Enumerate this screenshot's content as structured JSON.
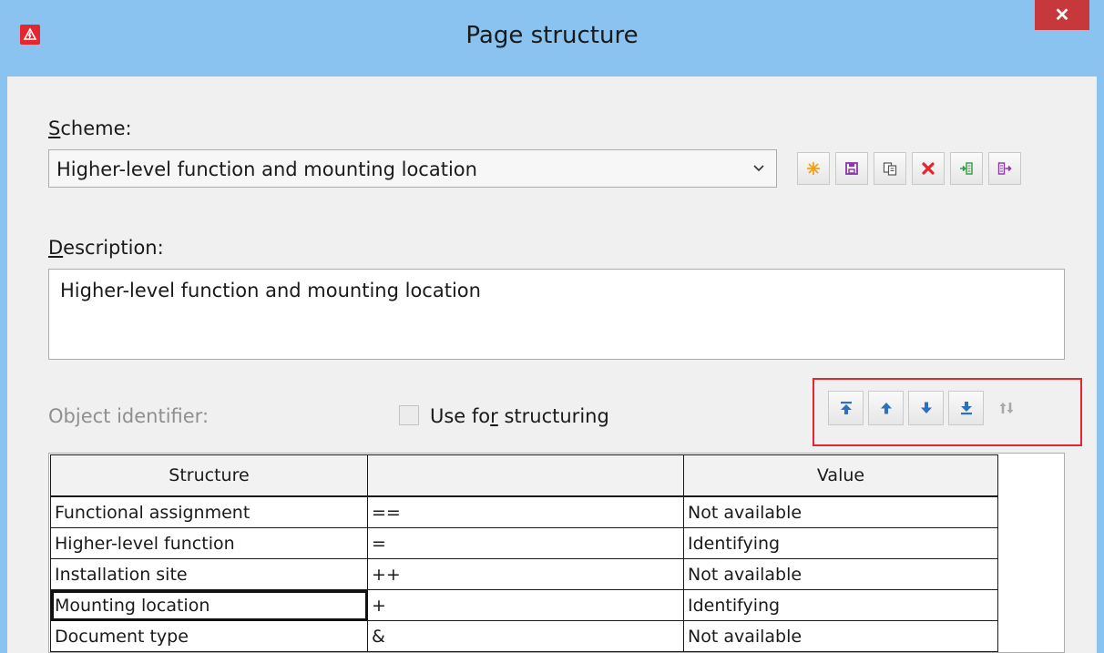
{
  "window": {
    "title": "Page structure",
    "close": "✕"
  },
  "scheme": {
    "label_prefix": "",
    "label_mnemonic": "S",
    "label_rest": "cheme:",
    "value": "Higher-level function and mounting location"
  },
  "toolbar_icons": [
    "new-icon",
    "save-icon",
    "copy-icon",
    "delete-icon",
    "import-icon",
    "export-icon"
  ],
  "description": {
    "label_mnemonic": "D",
    "label_rest": "escription:",
    "value": "Higher-level function and mounting location"
  },
  "object_identifier": {
    "label": "Object identifier:"
  },
  "use_for_structuring": {
    "label_before": "Use fo",
    "label_mnemonic": "r",
    "label_after": " structuring",
    "checked": false
  },
  "move_buttons": [
    "move-to-top-icon",
    "move-up-icon",
    "move-down-icon",
    "move-to-bottom-icon",
    "sort-icon"
  ],
  "table": {
    "headers": [
      "Structure",
      "",
      "Value"
    ],
    "rows": [
      [
        "Functional assignment",
        "==",
        "Not available"
      ],
      [
        "Higher-level function",
        "=",
        "Identifying"
      ],
      [
        "Installation site",
        "++",
        "Not available"
      ],
      [
        "Mounting location",
        "+",
        "Identifying"
      ],
      [
        "Document type",
        "&",
        "Not available"
      ]
    ]
  },
  "colors": {
    "accent": "#e3262f",
    "titlebar": "#8ac3ef",
    "close": "#c7383c"
  }
}
